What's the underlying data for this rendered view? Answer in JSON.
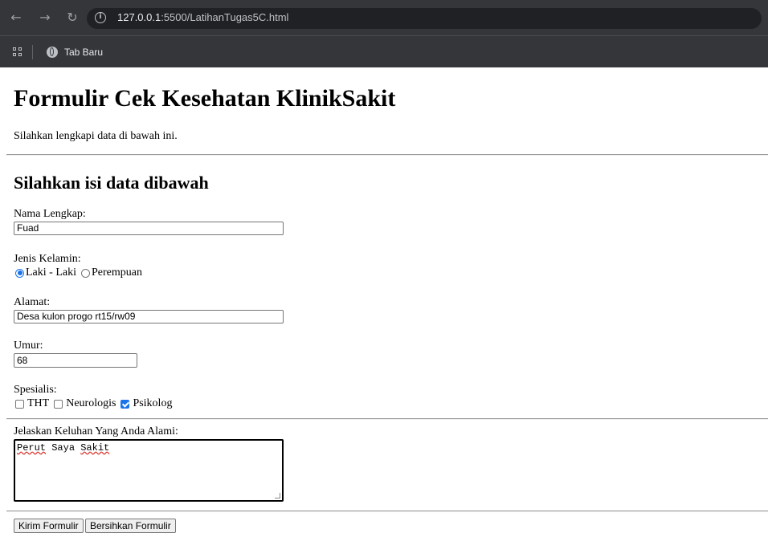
{
  "browser": {
    "url_host": "127.0.0.1",
    "url_rest": ":5500/LatihanTugas5C.html",
    "bookmark_label": "Tab Baru"
  },
  "page": {
    "title": "Formulir Cek Kesehatan KlinikSakit",
    "intro": "Silahkan lengkapi data di bawah ini.",
    "subtitle": "Silahkan isi data dibawah"
  },
  "form": {
    "nama_label": "Nama Lengkap:",
    "nama_value": "Fuad",
    "jk_label": "Jenis Kelamin:",
    "jk_options": [
      "Laki - Laki",
      "Perempuan"
    ],
    "jk_selected": "Laki - Laki",
    "alamat_label": "Alamat:",
    "alamat_value": "Desa kulon progo rt15/rw09",
    "umur_label": "Umur:",
    "umur_value": "68",
    "spesialis_label": "Spesialis:",
    "spesialis_options": [
      "THT",
      "Neurologis",
      "Psikolog"
    ],
    "spesialis_checked": [
      "Psikolog"
    ],
    "keluhan_label": "Jelaskan Keluhan Yang Anda Alami:",
    "keluhan_words": [
      "Perut",
      "Saya",
      "Sakit"
    ],
    "submit_label": "Kirim Formulir",
    "reset_label": "Bersihkan Formulir"
  }
}
